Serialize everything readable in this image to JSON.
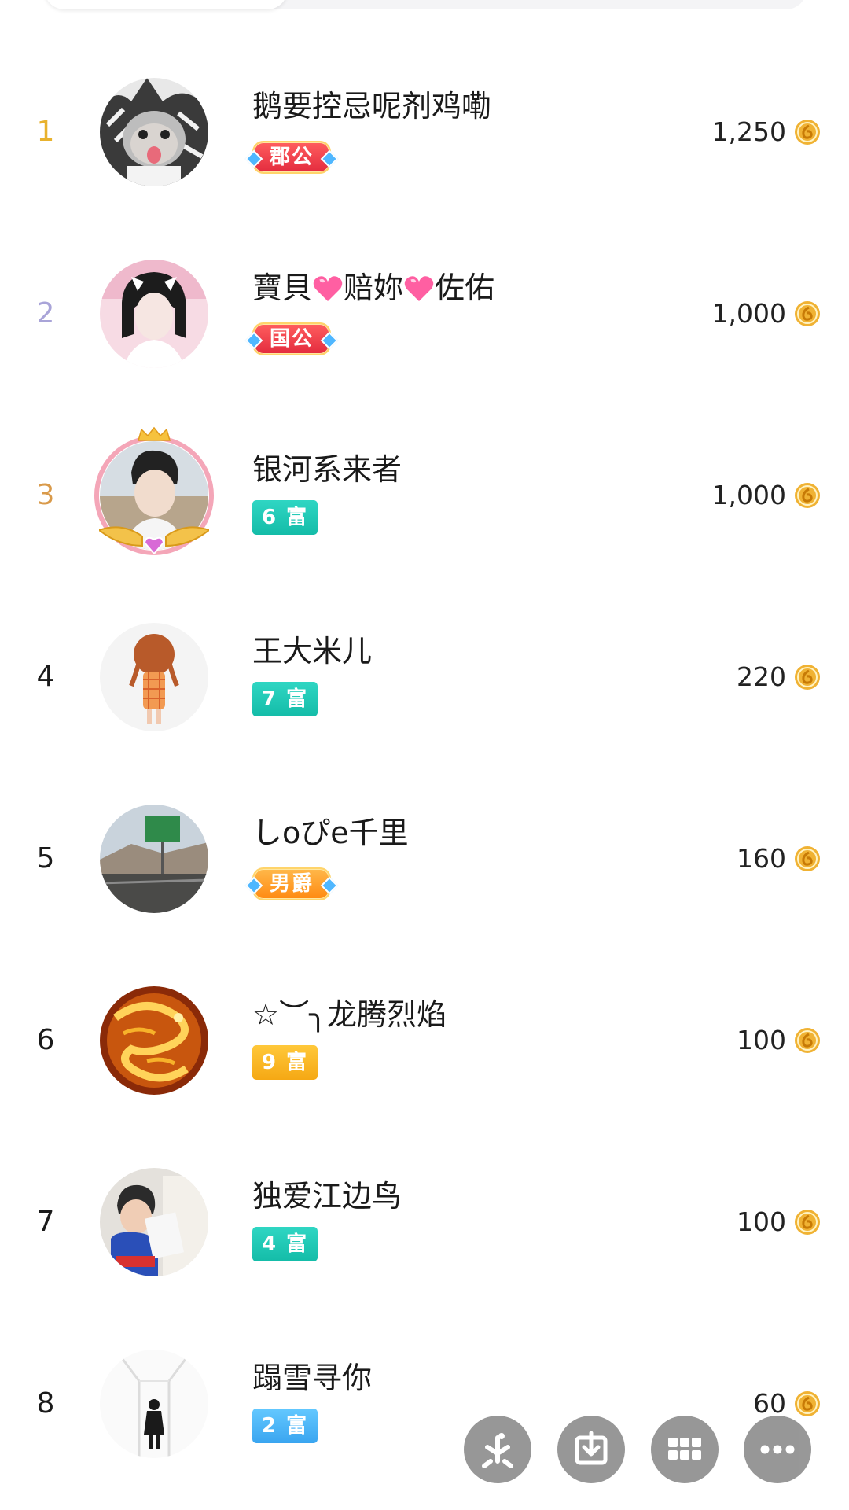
{
  "colors": {
    "rank1": "#e8b22e",
    "rank2": "#a9a4d8",
    "rank3": "#d99a4a",
    "coin": "#f0b233",
    "fab": "#8f8f8f"
  },
  "entries": [
    {
      "rank": "1",
      "name": "鹅要控忌呢剂鸡嘞",
      "badge": "郡公",
      "badge_type": "noble-red",
      "amount": "1,250",
      "avatar": "cat-hood-avatar"
    },
    {
      "rank": "2",
      "name_parts": [
        "寶貝",
        "赔妳",
        "佐佑"
      ],
      "badge": "国公",
      "badge_type": "noble-red",
      "amount": "1,000",
      "avatar": "girl-avatar"
    },
    {
      "rank": "3",
      "name": "银河系来者",
      "badge": "6 富",
      "badge_type": "rich-teal",
      "amount": "1,000",
      "avatar": "man-avatar-framed"
    },
    {
      "rank": "4",
      "name": "王大米儿",
      "badge": "7 富",
      "badge_type": "rich-teal",
      "amount": "220",
      "avatar": "cartoon-girl-avatar"
    },
    {
      "rank": "5",
      "name": "しoぴe千里",
      "badge": "男爵",
      "badge_type": "noble-orange",
      "amount": "160",
      "avatar": "highway-avatar"
    },
    {
      "rank": "6",
      "name": "☆︶╮龙腾烈焰",
      "badge": "9 富",
      "badge_type": "rich-gold",
      "amount": "100",
      "avatar": "golden-dragon-avatar"
    },
    {
      "rank": "7",
      "name": "独爱江边鸟",
      "badge": "4 富",
      "badge_type": "rich-teal",
      "amount": "100",
      "avatar": "child-reading-avatar"
    },
    {
      "rank": "8",
      "name": "蹋雪寻你",
      "badge": "2 富",
      "badge_type": "rich-blue",
      "amount": "60",
      "avatar": "white-corridor-avatar"
    }
  ],
  "floating_buttons": [
    "six-logo-icon",
    "download-icon",
    "grid-icon",
    "more-icon"
  ]
}
